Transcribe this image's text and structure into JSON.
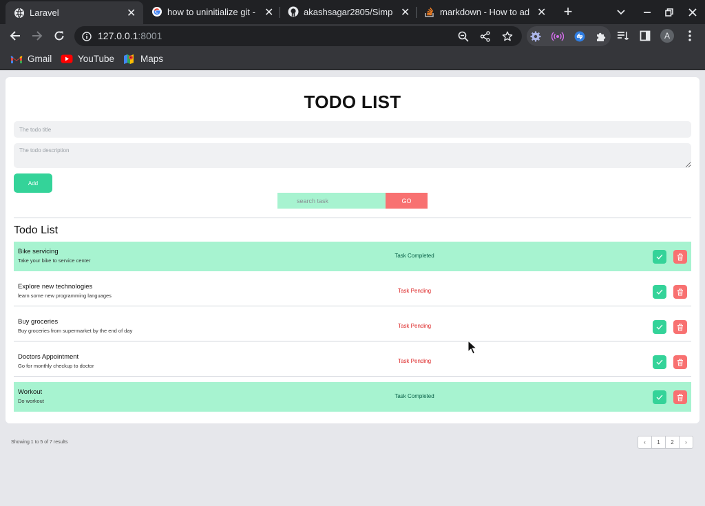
{
  "browser": {
    "tabs": [
      {
        "title": "Laravel",
        "active": true
      },
      {
        "title": "how to uninitialize git -",
        "active": false
      },
      {
        "title": "akashsagar2805/Simpl",
        "active": false
      },
      {
        "title": "markdown - How to ad",
        "active": false
      }
    ],
    "url_host": "127.0.0.1",
    "url_port": ":8001",
    "profile_initial": "A",
    "bookmarks": [
      "Gmail",
      "YouTube",
      "Maps"
    ]
  },
  "page": {
    "title": "TODO LIST",
    "title_placeholder": "The todo title",
    "description_placeholder": "The todo description",
    "add_label": "Add",
    "search_placeholder": "search task",
    "go_label": "GO",
    "list_heading": "Todo List",
    "todos": [
      {
        "title": "Bike servicing",
        "description": "Take your bike to service center",
        "status": "Task Completed",
        "completed": true
      },
      {
        "title": "Explore new technologies",
        "description": "learn some new programming languages",
        "status": "Task Pending",
        "completed": false
      },
      {
        "title": "Buy groceries",
        "description": "Buy groceries from supermarket by the end of day",
        "status": "Task Pending",
        "completed": false
      },
      {
        "title": "Doctors Appointment",
        "description": "Go for monthly checkup to doctor",
        "status": "Task Pending",
        "completed": false
      },
      {
        "title": "Workout",
        "description": "Do workout",
        "status": "Task Completed",
        "completed": true
      }
    ],
    "showing_text": "Showing 1 to 5 of 7 results",
    "pagination": {
      "prev": "‹",
      "pages": [
        "1",
        "2"
      ],
      "next": "›"
    }
  },
  "colors": {
    "accent_green": "#34d399",
    "light_green": "#a7f3d0",
    "accent_red": "#f87171"
  }
}
